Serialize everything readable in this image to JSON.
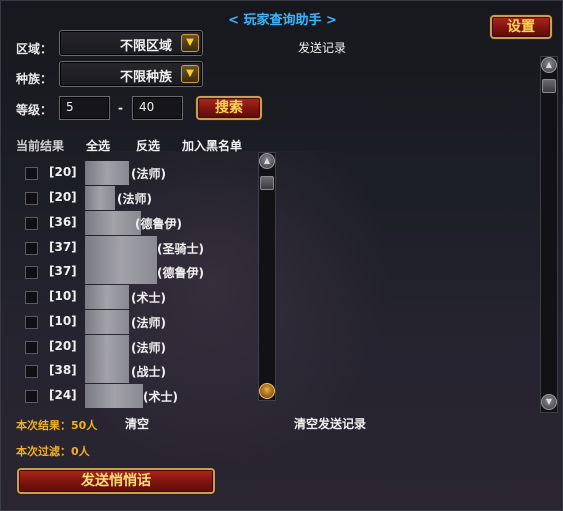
{
  "window": {
    "title": "< 玩家查询助手 >",
    "settings_label": "设置"
  },
  "filters": {
    "region_label": "区域：",
    "region_value": "不限区域",
    "race_label": "种族：",
    "race_value": "不限种族",
    "level_label": "等级：",
    "level_min": "5",
    "level_sep": "-",
    "level_max": "40",
    "search_label": "搜索"
  },
  "send_log": {
    "title": "发送记录"
  },
  "results": {
    "header": "当前结果",
    "select_all": "全选",
    "invert": "反选",
    "blacklist": "加入黑名单",
    "rows": [
      {
        "level": "[20]",
        "class": "(法师)"
      },
      {
        "level": "[20]",
        "class": "(法师)"
      },
      {
        "level": "[36]",
        "class": "(德鲁伊)"
      },
      {
        "level": "[37]",
        "class": "(圣骑士)"
      },
      {
        "level": "[37]",
        "class": "(德鲁伊)"
      },
      {
        "level": "[10]",
        "class": "(术士)"
      },
      {
        "level": "[10]",
        "class": "(法师)"
      },
      {
        "level": "[20]",
        "class": "(法师)"
      },
      {
        "level": "[38]",
        "class": "(战士)"
      },
      {
        "level": "[24]",
        "class": "(术士)"
      }
    ]
  },
  "footer": {
    "result_count": "本次结果：50人",
    "clear_label": "清空",
    "clear_log_label": "清空发送记录",
    "filtered_count": "本次过滤：0人",
    "whisper_label": "发送悄悄话"
  },
  "colors": {
    "title": "#38b7ff",
    "accent": "#ffd850",
    "stat": "#f0b020",
    "button_red": "#8e1a12"
  }
}
